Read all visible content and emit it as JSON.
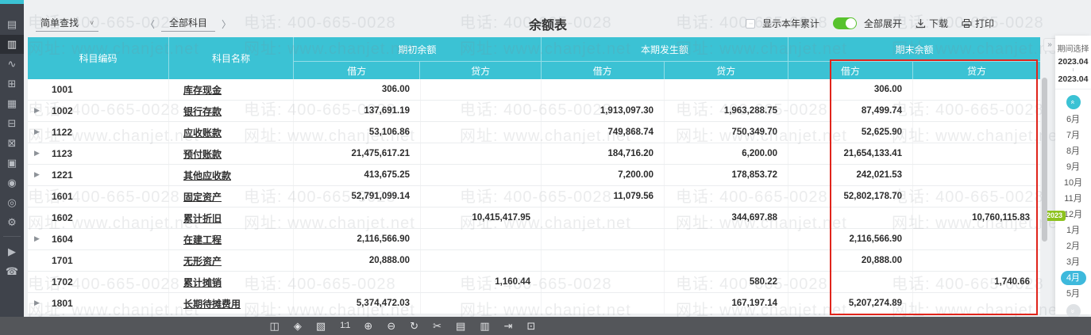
{
  "app": {
    "title": "余额表"
  },
  "toolbar": {
    "search_mode": "简单查找",
    "prev_arrow": "〈",
    "next_arrow": "〉",
    "scope": "全部科目",
    "show_ytd_label": "显示本年累计",
    "expand_all_label": "全部展开",
    "download_label": "下载",
    "print_label": "打印"
  },
  "table": {
    "headers": {
      "code": "科目编码",
      "name": "科目名称",
      "opening": "期初余额",
      "current": "本期发生额",
      "ending": "期末余额",
      "debit": "借方",
      "credit": "贷方"
    },
    "rows": [
      {
        "code": "1001",
        "name": "库存现金",
        "expandable": false,
        "op_debit": "306.00",
        "op_credit": "",
        "cur_debit": "",
        "cur_credit": "",
        "end_debit": "306.00",
        "end_credit": ""
      },
      {
        "code": "1002",
        "name": "银行存款",
        "expandable": true,
        "op_debit": "137,691.19",
        "op_credit": "",
        "cur_debit": "1,913,097.30",
        "cur_credit": "1,963,288.75",
        "end_debit": "87,499.74",
        "end_credit": ""
      },
      {
        "code": "1122",
        "name": "应收账款",
        "expandable": true,
        "op_debit": "53,106.86",
        "op_credit": "",
        "cur_debit": "749,868.74",
        "cur_credit": "750,349.70",
        "end_debit": "52,625.90",
        "end_credit": ""
      },
      {
        "code": "1123",
        "name": "预付账款",
        "expandable": true,
        "op_debit": "21,475,617.21",
        "op_credit": "",
        "cur_debit": "184,716.20",
        "cur_credit": "6,200.00",
        "end_debit": "21,654,133.41",
        "end_credit": ""
      },
      {
        "code": "1221",
        "name": "其他应收款",
        "expandable": true,
        "op_debit": "413,675.25",
        "op_credit": "",
        "cur_debit": "7,200.00",
        "cur_credit": "178,853.72",
        "end_debit": "242,021.53",
        "end_credit": ""
      },
      {
        "code": "1601",
        "name": "固定资产",
        "expandable": false,
        "op_debit": "52,791,099.14",
        "op_credit": "",
        "cur_debit": "11,079.56",
        "cur_credit": "",
        "end_debit": "52,802,178.70",
        "end_credit": ""
      },
      {
        "code": "1602",
        "name": "累计折旧",
        "expandable": false,
        "op_debit": "",
        "op_credit": "10,415,417.95",
        "cur_debit": "",
        "cur_credit": "344,697.88",
        "end_debit": "",
        "end_credit": "10,760,115.83"
      },
      {
        "code": "1604",
        "name": "在建工程",
        "expandable": true,
        "op_debit": "2,116,566.90",
        "op_credit": "",
        "cur_debit": "",
        "cur_credit": "",
        "end_debit": "2,116,566.90",
        "end_credit": ""
      },
      {
        "code": "1701",
        "name": "无形资产",
        "expandable": false,
        "op_debit": "20,888.00",
        "op_credit": "",
        "cur_debit": "",
        "cur_credit": "",
        "end_debit": "20,888.00",
        "end_credit": ""
      },
      {
        "code": "1702",
        "name": "累计摊销",
        "expandable": false,
        "op_debit": "",
        "op_credit": "1,160.44",
        "cur_debit": "",
        "cur_credit": "580.22",
        "end_debit": "",
        "end_credit": "1,740.66"
      },
      {
        "code": "1801",
        "name": "长期待摊费用",
        "expandable": true,
        "op_debit": "5,374,472.03",
        "op_credit": "",
        "cur_debit": "",
        "cur_credit": "167,197.14",
        "end_debit": "5,207,274.89",
        "end_credit": ""
      }
    ]
  },
  "period_panel": {
    "title": "期间选择",
    "from": "2023.04",
    "to": "2023.04",
    "collapse_glyph": "»",
    "scroll_up_glyph": "«",
    "scroll_down_glyph": "»",
    "year_badge": "2023",
    "months": [
      "6月",
      "7月",
      "8月",
      "9月",
      "10月",
      "11月",
      "12月",
      "1月",
      "2月",
      "3月",
      "4月",
      "5月"
    ],
    "selected_month": "4月"
  },
  "sidebar": {
    "items": [
      {
        "name": "voucher-icon",
        "glyph": "▤",
        "active": false
      },
      {
        "name": "ledger-icon",
        "glyph": "▥",
        "active": true
      },
      {
        "name": "report-chart-icon",
        "glyph": "∿",
        "active": false
      },
      {
        "name": "documents-icon",
        "glyph": "⊞",
        "active": false
      },
      {
        "name": "calendar-icon",
        "glyph": "▦",
        "active": false
      },
      {
        "name": "invoice-icon",
        "glyph": "⊟",
        "active": false
      },
      {
        "name": "cashier-icon",
        "glyph": "⊠",
        "active": false
      },
      {
        "name": "fixed-assets-icon",
        "glyph": "▣",
        "active": false
      },
      {
        "name": "salary-icon",
        "glyph": "◉",
        "active": false
      },
      {
        "name": "audit-search-icon",
        "glyph": "◎",
        "active": false
      },
      {
        "name": "settings-gear-icon",
        "glyph": "⚙",
        "active": false
      },
      {
        "name": "video-tutorial-icon",
        "glyph": "▶",
        "active": false,
        "after_divider": true
      },
      {
        "name": "customer-service-icon",
        "glyph": "☎",
        "active": false,
        "after_divider": true
      }
    ]
  },
  "bottom_toolbar": {
    "items": [
      {
        "name": "panel-icon",
        "glyph": "◫"
      },
      {
        "name": "magic-select-icon",
        "glyph": "◈"
      },
      {
        "name": "image-edit-icon",
        "glyph": "▧"
      },
      {
        "name": "actual-size-icon",
        "glyph": "1:1",
        "is_text": true
      },
      {
        "name": "zoom-in-icon",
        "glyph": "⊕"
      },
      {
        "name": "zoom-out-icon",
        "glyph": "⊖"
      },
      {
        "name": "rotate-icon",
        "glyph": "↻"
      },
      {
        "name": "cut-icon",
        "glyph": "✂"
      },
      {
        "name": "save-word-icon",
        "glyph": "▤"
      },
      {
        "name": "save-image-icon",
        "glyph": "▥"
      },
      {
        "name": "export-icon",
        "glyph": "⇥"
      },
      {
        "name": "print-icon",
        "glyph": "⊡"
      }
    ]
  },
  "watermark": {
    "phone": "电话: 400-665-0028",
    "site": "网址: www.chanjet.net"
  },
  "colors": {
    "accent_teal": "#3bc2d4",
    "highlight_red": "#e0241b",
    "toggle_green": "#57c22d",
    "year_badge_green": "#8dc21f",
    "selected_month_blue": "#3eb9dc",
    "sidebar_dark": "#3f434b",
    "bottombar_dark": "#54565a"
  }
}
